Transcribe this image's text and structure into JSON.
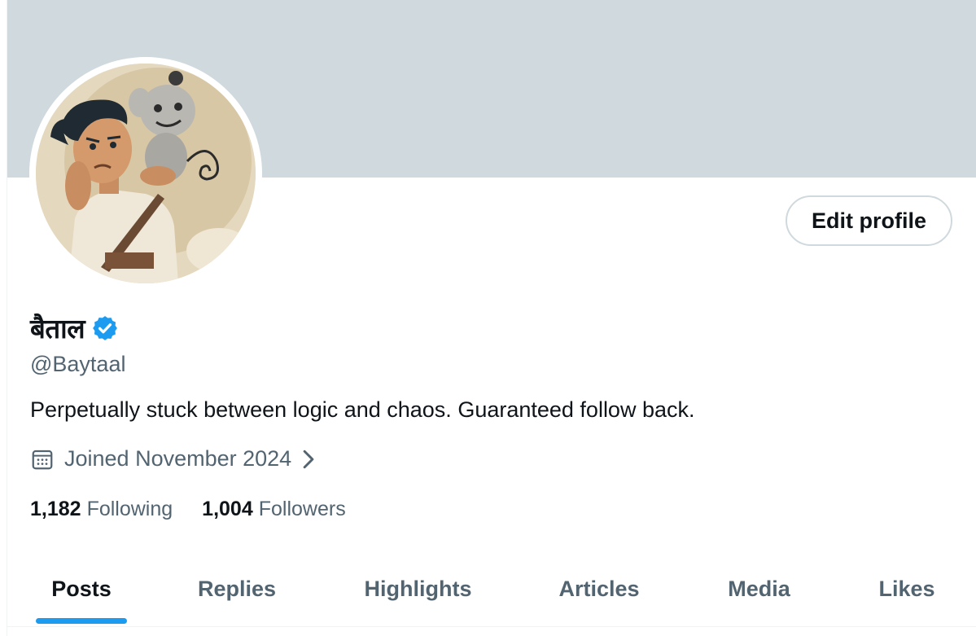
{
  "profile": {
    "display_name": "बैताल",
    "handle": "@Baytaal",
    "bio": "Perpetually stuck between logic and chaos. Guaranteed follow back.",
    "joined": "Joined November 2024",
    "verified_badge_color": "#1d9bf0"
  },
  "actions": {
    "edit_profile_label": "Edit profile"
  },
  "stats": {
    "following_count": "1,182",
    "following_label": "Following",
    "followers_count": "1,004",
    "followers_label": "Followers"
  },
  "tabs": [
    {
      "label": "Posts",
      "active": true
    },
    {
      "label": "Replies",
      "active": false
    },
    {
      "label": "Highlights",
      "active": false
    },
    {
      "label": "Articles",
      "active": false
    },
    {
      "label": "Media",
      "active": false
    },
    {
      "label": "Likes",
      "active": false
    }
  ],
  "icons": {
    "verified": "verified-badge-icon",
    "calendar": "calendar-icon",
    "chevron": "chevron-right-icon"
  },
  "colors": {
    "banner": "#cfd9de",
    "accent": "#1d9bf0",
    "secondary_text": "#536471",
    "primary_text": "#0f1419"
  }
}
